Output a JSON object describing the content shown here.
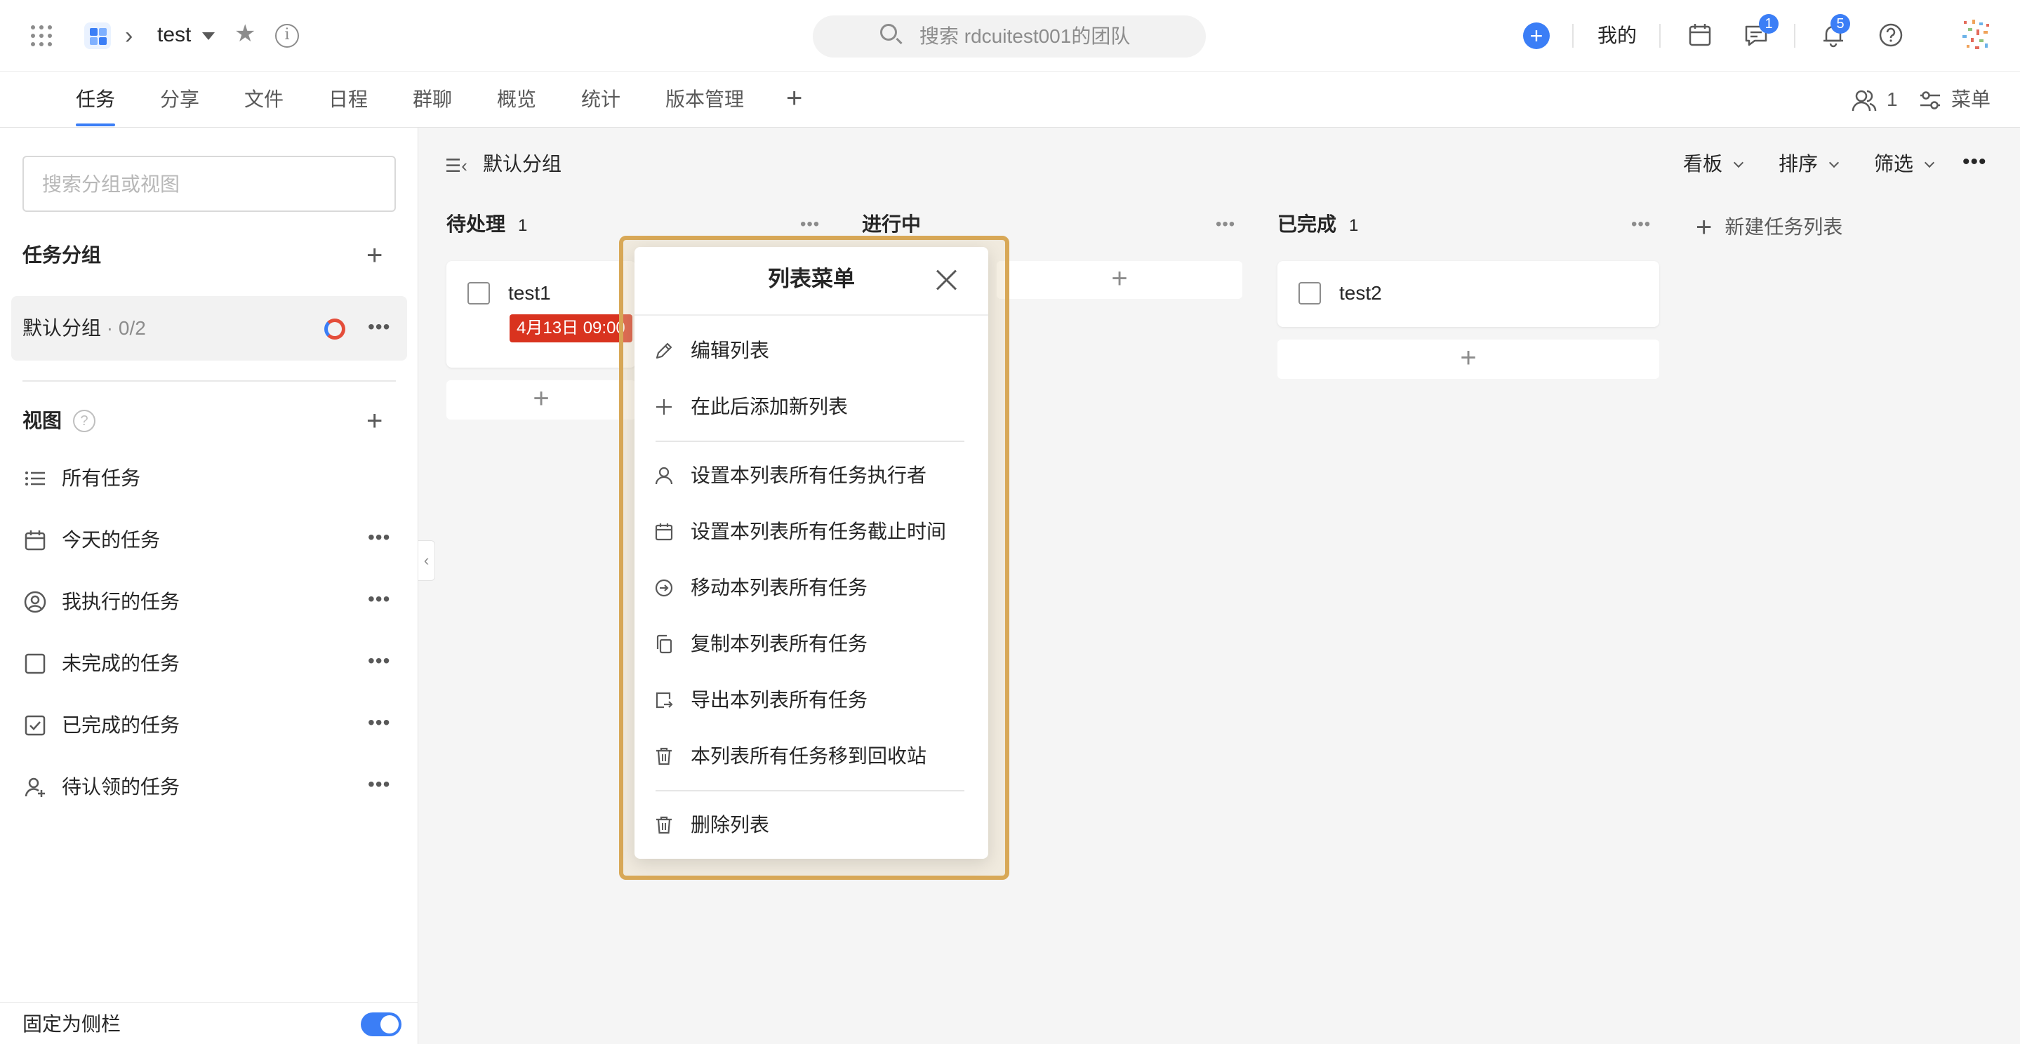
{
  "topbar": {
    "project_name": "test",
    "search_placeholder": "搜索 rdcuitest001的团队",
    "mine_label": "我的",
    "messages_badge": "1",
    "notifications_badge": "5",
    "accent_color": "#3b7ef6"
  },
  "tabs": [
    {
      "label": "任务",
      "active": true
    },
    {
      "label": "分享"
    },
    {
      "label": "文件"
    },
    {
      "label": "日程"
    },
    {
      "label": "群聊"
    },
    {
      "label": "概览"
    },
    {
      "label": "统计"
    },
    {
      "label": "版本管理"
    }
  ],
  "tabbar_right": {
    "members_count": "1",
    "menu_label": "菜单"
  },
  "sidebar": {
    "search_placeholder": "搜索分组或视图",
    "groups_heading": "任务分组",
    "group": {
      "name": "默认分组",
      "count": "· 0/2"
    },
    "views_heading": "视图",
    "views": [
      {
        "label": "所有任务",
        "icon": "list-icon"
      },
      {
        "label": "今天的任务",
        "icon": "calendar-icon"
      },
      {
        "label": "我执行的任务",
        "icon": "user-circle-icon"
      },
      {
        "label": "未完成的任务",
        "icon": "checkbox-empty-icon"
      },
      {
        "label": "已完成的任务",
        "icon": "checkbox-checked-icon"
      },
      {
        "label": "待认领的任务",
        "icon": "user-plus-icon"
      }
    ],
    "pin_label": "固定为侧栏",
    "pin_enabled": true
  },
  "board": {
    "group_title": "默认分组",
    "controls": {
      "view": "看板",
      "sort": "排序",
      "filter": "筛选"
    },
    "columns": [
      {
        "name": "待处理",
        "count": "1",
        "cards": [
          {
            "title": "test1",
            "due": "4月13日 09:00",
            "due_color": "#d9331f"
          }
        ]
      },
      {
        "name": "进行中",
        "count": "",
        "cards": []
      },
      {
        "name": "已完成",
        "count": "1",
        "cards": [
          {
            "title": "test2"
          }
        ]
      }
    ],
    "new_list_label": "新建任务列表"
  },
  "popup": {
    "title": "列表菜单",
    "items": [
      {
        "label": "编辑列表",
        "icon": "edit-icon"
      },
      {
        "label": "在此后添加新列表",
        "icon": "plus-icon"
      },
      {
        "label": "设置本列表所有任务执行者",
        "icon": "user-icon"
      },
      {
        "label": "设置本列表所有任务截止时间",
        "icon": "calendar-icon"
      },
      {
        "label": "移动本列表所有任务",
        "icon": "move-icon"
      },
      {
        "label": "复制本列表所有任务",
        "icon": "copy-icon"
      },
      {
        "label": "导出本列表所有任务",
        "icon": "export-icon"
      },
      {
        "label": "本列表所有任务移到回收站",
        "icon": "trash-icon"
      },
      {
        "label": "删除列表",
        "icon": "trash-icon"
      }
    ],
    "highlight_color": "#d8a857"
  }
}
